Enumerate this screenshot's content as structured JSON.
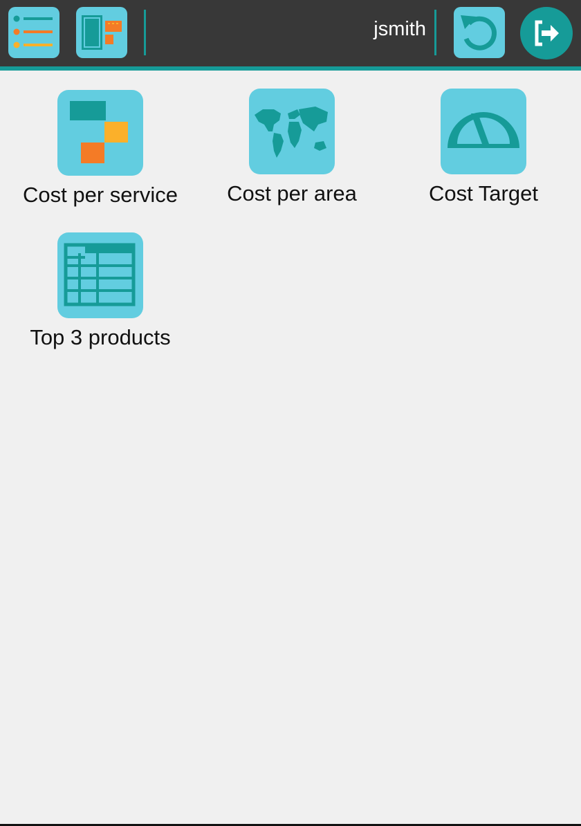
{
  "header": {
    "username": "jsmith",
    "buttons": {
      "menu_icon": "list-menu-icon",
      "dashboard_icon": "dashboard-layout-icon",
      "refresh_icon": "refresh-icon",
      "logout_icon": "logout-icon"
    }
  },
  "tiles": [
    {
      "label": "Cost per service",
      "icon": "service-blocks-icon"
    },
    {
      "label": "Cost per area",
      "icon": "world-map-icon"
    },
    {
      "label": "Cost Target",
      "icon": "gauge-icon"
    },
    {
      "label": "Top 3 products",
      "icon": "table-icon"
    }
  ],
  "colors": {
    "topbar": "#383838",
    "accent": "#169b98",
    "icon_bg": "#62cde0",
    "orange": "#f47b26",
    "yellow": "#fbb02a",
    "background": "#f0f0f0"
  }
}
